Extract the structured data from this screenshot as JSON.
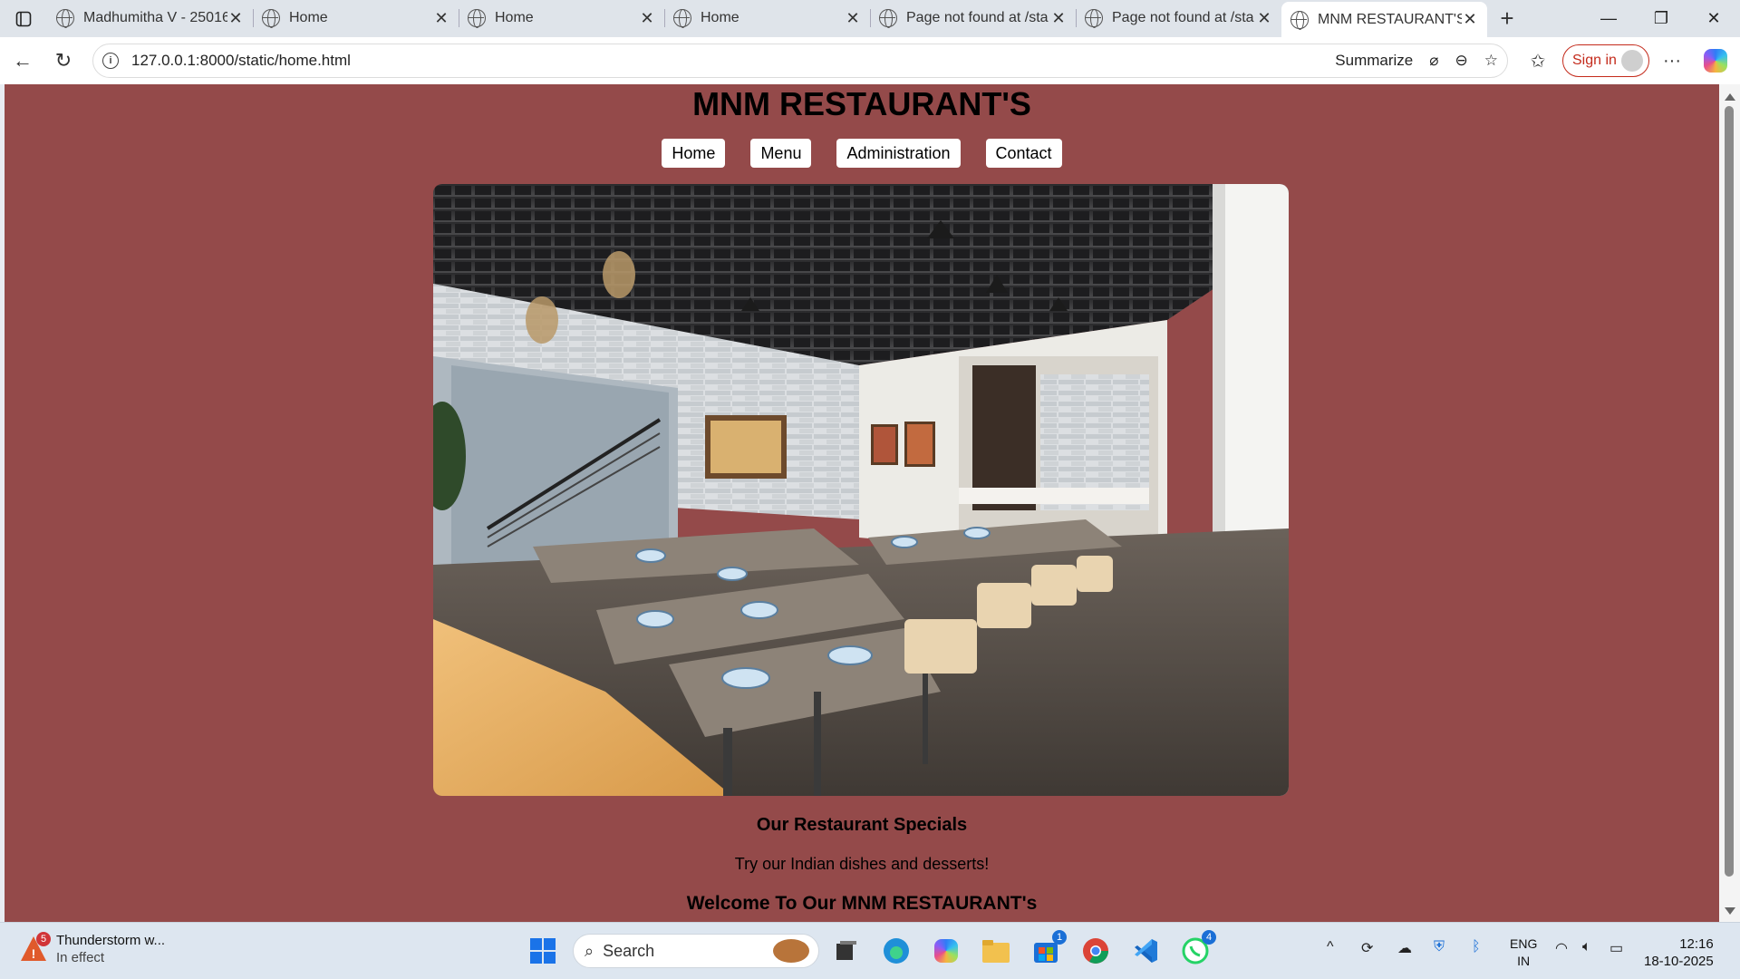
{
  "browser": {
    "tabs": [
      {
        "title": "Madhumitha V - 25016",
        "active": false
      },
      {
        "title": "Home",
        "active": false
      },
      {
        "title": "Home",
        "active": false
      },
      {
        "title": "Home",
        "active": false
      },
      {
        "title": "Page not found at /sta",
        "active": false
      },
      {
        "title": "Page not found at /sta",
        "active": false
      },
      {
        "title": "MNM RESTAURANT'S",
        "active": true
      }
    ],
    "url": "127.0.0.1:8000/static/home.html",
    "summarize_label": "Summarize",
    "signin_label": "Sign in"
  },
  "page": {
    "title": "MNM RESTAURANT'S",
    "nav": [
      "Home",
      "Menu",
      "Administration",
      "Contact"
    ],
    "specials_title": "Our Restaurant Specials",
    "specials_text": "Try our Indian dishes and desserts!",
    "welcome": "Welcome To Our MNM RESTAURANT's",
    "background_color": "#944a4a"
  },
  "taskbar": {
    "weather_title": "Thunderstorm w...",
    "weather_sub": "In effect",
    "weather_badge": "5",
    "search_placeholder": "Search",
    "store_badge": "1",
    "whatsapp_badge": "4",
    "lang_line1": "ENG",
    "lang_line2": "IN",
    "time": "12:16",
    "date": "18-10-2025"
  }
}
